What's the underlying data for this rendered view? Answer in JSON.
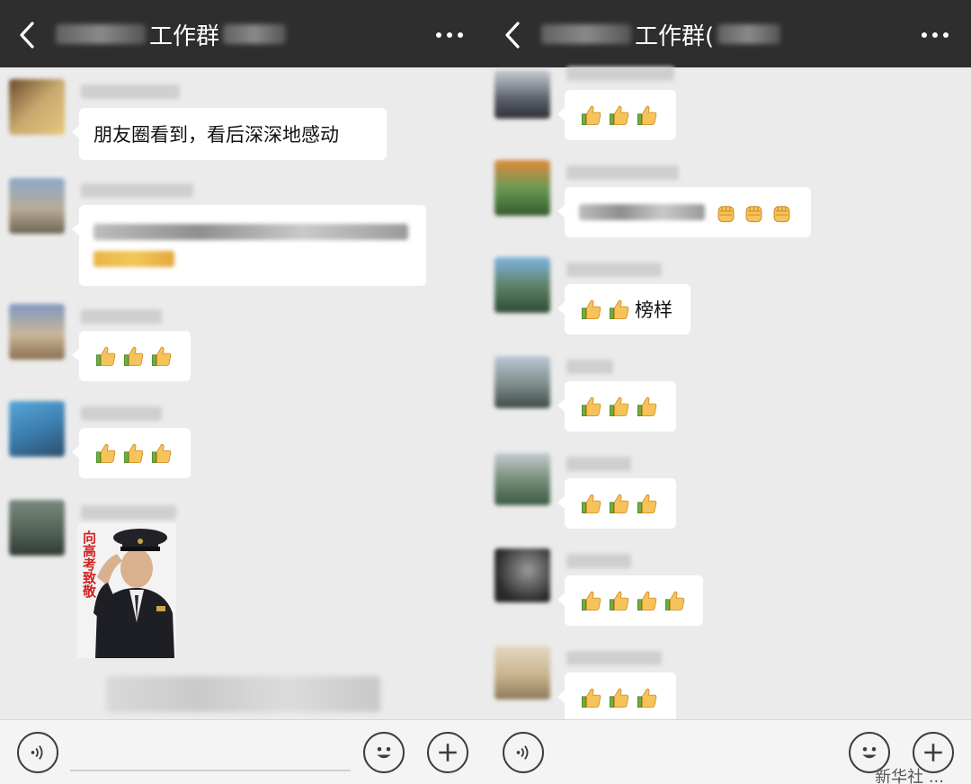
{
  "left": {
    "title": "工作群",
    "messages": [
      {
        "text": "朋友圈看到，看后深深地感动"
      },
      {
        "text": ""
      },
      {
        "thumbs": 3
      },
      {
        "thumbs": 3
      },
      {
        "sticker_text": "向高考致敬"
      }
    ]
  },
  "right": {
    "title": "工作群(",
    "messages": [
      {
        "thumbs": 3
      },
      {
        "fists": 3
      },
      {
        "thumbs": 2,
        "suffix": "榜样"
      },
      {
        "thumbs": 3
      },
      {
        "thumbs": 3
      },
      {
        "thumbs": 4
      },
      {
        "thumbs": 3
      }
    ]
  },
  "watermark": "新华社 ..."
}
